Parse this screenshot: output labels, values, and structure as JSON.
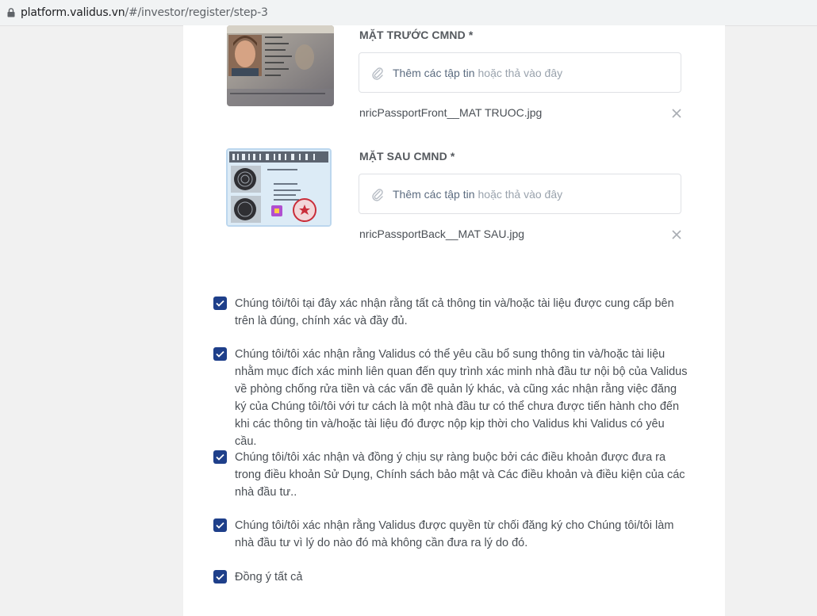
{
  "browser": {
    "url_domain": "platform.validus.vn",
    "url_path": "/#/investor/register/step-3"
  },
  "uploads": [
    {
      "label": "MẶT TRƯỚC CMND *",
      "dropzone_action": "Thêm các tập tin",
      "dropzone_hint": "hoặc thả vào đây",
      "filename": "nricPassportFront__MAT TRUOC.jpg"
    },
    {
      "label": "MẶT SAU CMND *",
      "dropzone_action": "Thêm các tập tin",
      "dropzone_hint": "hoặc thả vào đây",
      "filename": "nricPassportBack__MAT SAU.jpg"
    }
  ],
  "consents": [
    {
      "checked": true,
      "text": "Chúng tôi/tôi tại đây xác nhận rằng tất cả thông tin và/hoặc tài liệu được cung cấp bên trên là đúng, chính xác và đầy đủ."
    },
    {
      "checked": true,
      "text": "Chúng tôi/tôi xác nhận rằng Validus có thể yêu cầu bổ sung thông tin và/hoặc tài liệu nhằm mục đích xác minh liên quan đến quy trình xác minh nhà đầu tư nội bộ của Validus về phòng chống rửa tiền và các vấn đề quản lý khác, và cũng xác nhận rằng việc đăng ký của Chúng tôi/tôi với tư cách là một nhà đầu tư có thể chưa được tiến hành cho đến khi các thông tin và/hoặc tài liệu đó được nộp kịp thời cho Validus khi Validus có yêu cầu."
    },
    {
      "checked": true,
      "text": "Chúng tôi/tôi xác nhận và đồng ý chịu sự ràng buộc bởi các điều khoản được đưa ra trong điều khoản Sử Dụng, Chính sách bảo mật và Các điều khoản và điều kiện của các nhà đầu tư.."
    },
    {
      "checked": true,
      "text": "Chúng tôi/tôi xác nhận rằng Validus được quyền từ chối đăng ký cho Chúng tôi/tôi làm nhà đầu tư vì lý do nào đó mà không cần đưa ra lý do đó."
    },
    {
      "checked": true,
      "text": "Đồng ý tất cả"
    }
  ],
  "colors": {
    "checkbox": "#1e3f8a",
    "card": "#ffffff",
    "page_bg": "#f1f1f1"
  },
  "icons": [
    "lock-icon",
    "paperclip-icon",
    "close-icon",
    "checkmark-icon"
  ]
}
